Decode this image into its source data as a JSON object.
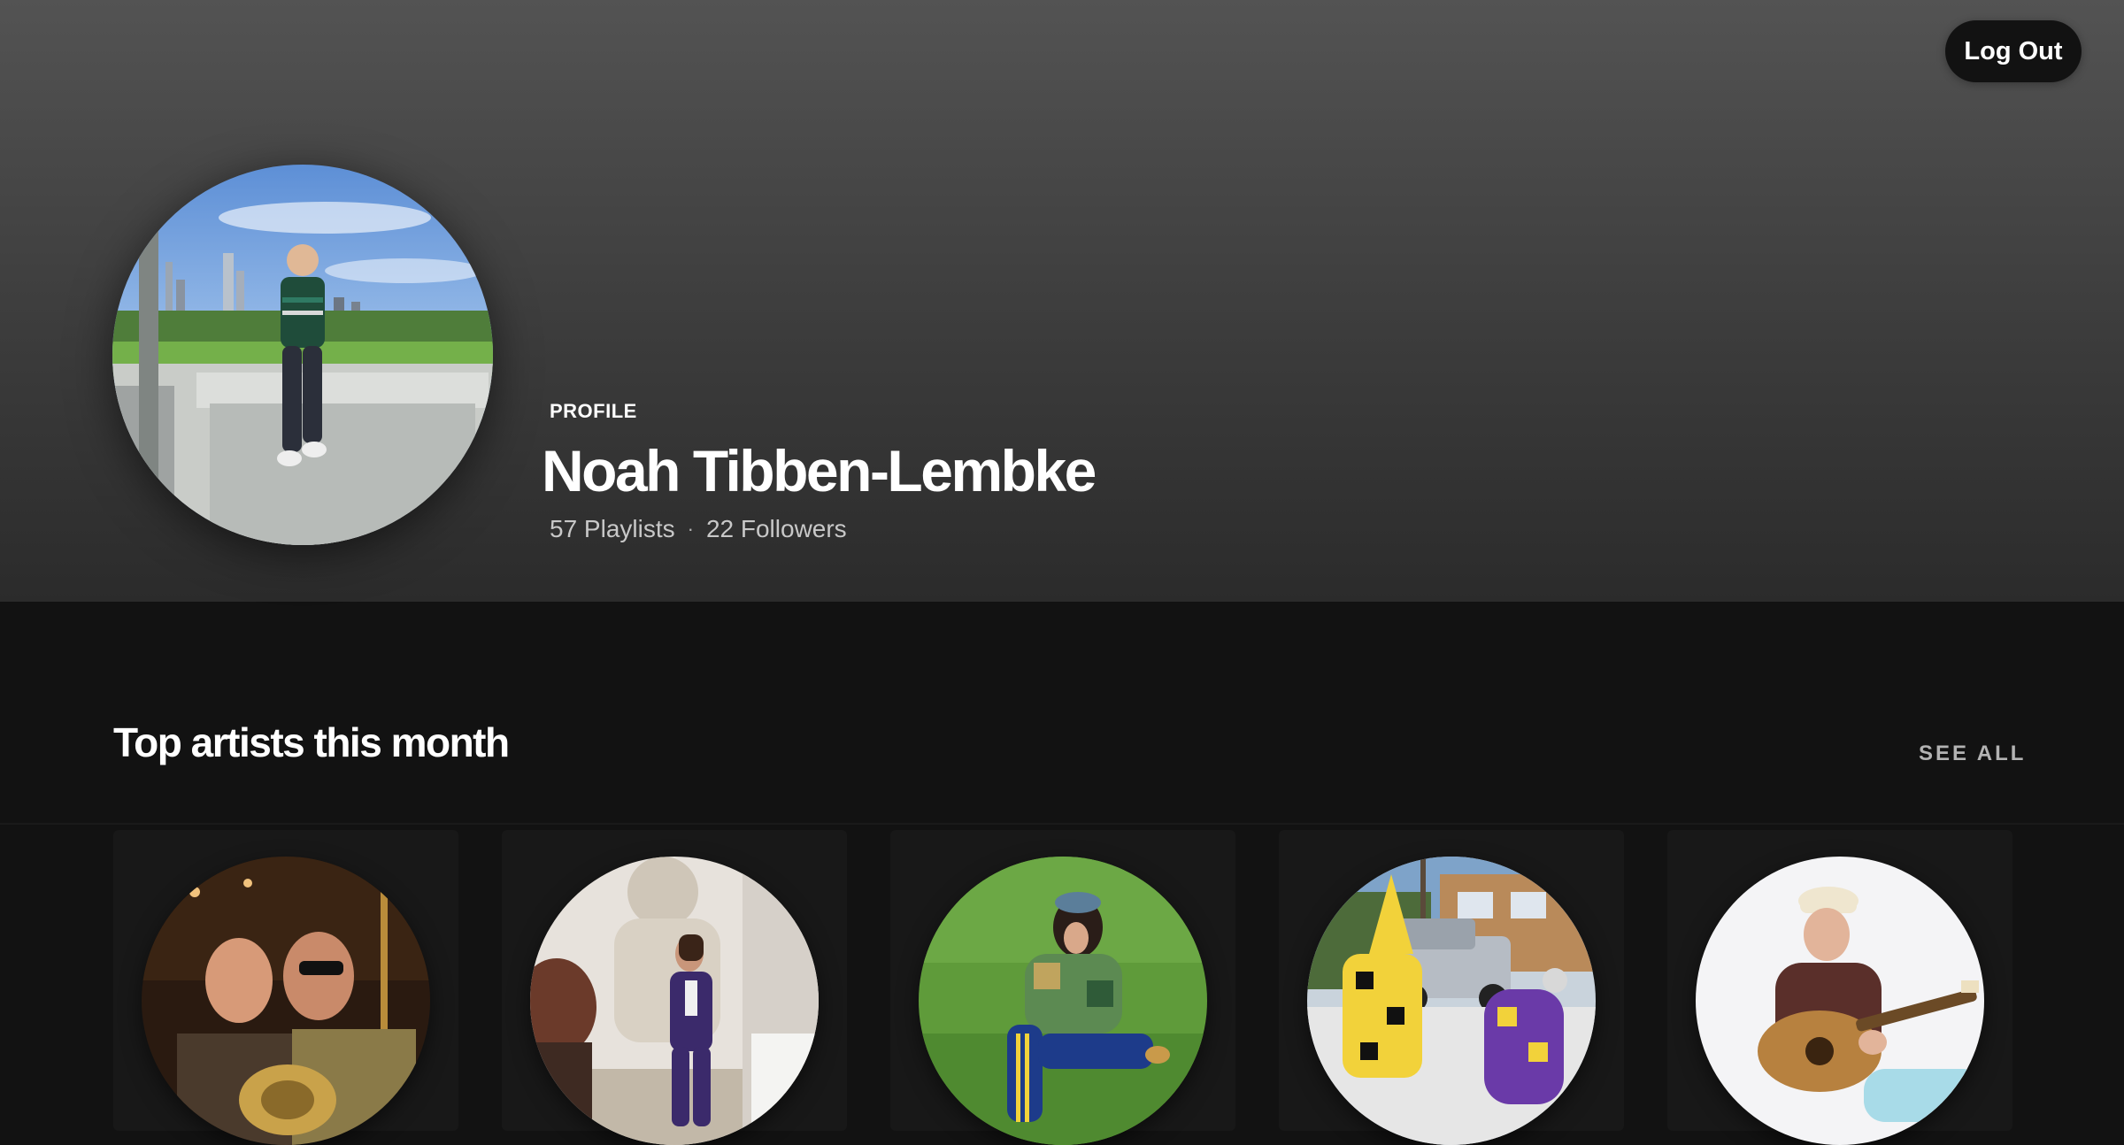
{
  "header": {
    "logout_label": "Log Out",
    "profile_label": "PROFILE",
    "display_name": "Noah Tibben-Lembke",
    "playlists_count": "57 Playlists",
    "followers_count": "22 Followers",
    "separator": "·"
  },
  "top_artists": {
    "title": "Top artists this month",
    "see_all_label": "SEE ALL",
    "artists": [
      {
        "image": "artist-photo-1-icon"
      },
      {
        "image": "artist-photo-2-icon"
      },
      {
        "image": "artist-photo-3-icon"
      },
      {
        "image": "artist-photo-4-icon"
      },
      {
        "image": "artist-photo-5-icon"
      }
    ]
  },
  "colors": {
    "background": "#121212",
    "header_top": "#535353",
    "card": "#181818",
    "muted_text": "#b3b3b3"
  }
}
